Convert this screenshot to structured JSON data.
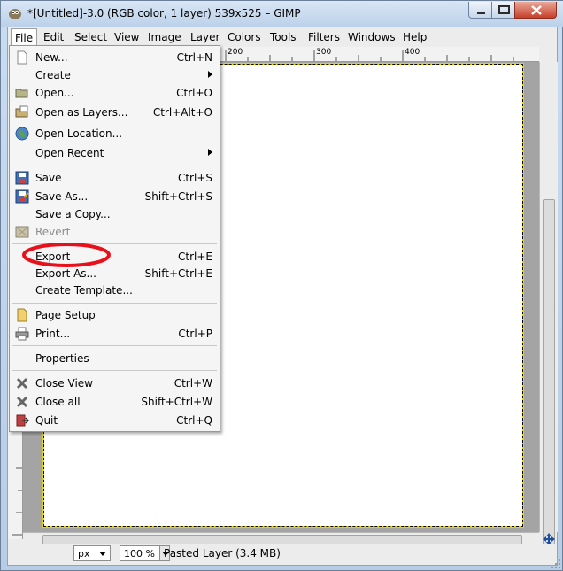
{
  "window": {
    "title": "*[Untitled]-3.0 (RGB color, 1 layer) 539x525 – GIMP",
    "icons": {
      "app": "gimp-icon",
      "minimize": "minimize-icon",
      "maximize": "maximize-icon",
      "close": "close-icon"
    }
  },
  "menubar": {
    "file": "File",
    "edit": "Edit",
    "select": "Select",
    "view": "View",
    "image": "Image",
    "layer": "Layer",
    "colors": "Colors",
    "tools": "Tools",
    "filters": "Filters",
    "windows": "Windows",
    "help": "Help"
  },
  "ruler": {
    "t200": "200",
    "t300": "300",
    "t400": "400"
  },
  "file_menu": {
    "new": {
      "label": "New...",
      "shortcut": "Ctrl+N"
    },
    "create": {
      "label": "Create"
    },
    "open": {
      "label": "Open...",
      "shortcut": "Ctrl+O"
    },
    "open_layers": {
      "label": "Open as Layers...",
      "shortcut": "Ctrl+Alt+O"
    },
    "open_location": {
      "label": "Open Location..."
    },
    "open_recent": {
      "label": "Open Recent"
    },
    "save": {
      "label": "Save",
      "shortcut": "Ctrl+S"
    },
    "save_as": {
      "label": "Save As...",
      "shortcut": "Shift+Ctrl+S"
    },
    "save_copy": {
      "label": "Save a Copy..."
    },
    "revert": {
      "label": "Revert"
    },
    "export": {
      "label": "Export",
      "shortcut": "Ctrl+E"
    },
    "export_as": {
      "label": "Export As...",
      "shortcut": "Shift+Ctrl+E"
    },
    "create_template": {
      "label": "Create Template..."
    },
    "page_setup": {
      "label": "Page Setup"
    },
    "print": {
      "label": "Print...",
      "shortcut": "Ctrl+P"
    },
    "properties": {
      "label": "Properties"
    },
    "close_view": {
      "label": "Close View",
      "shortcut": "Ctrl+W"
    },
    "close_all": {
      "label": "Close all",
      "shortcut": "Shift+Ctrl+W"
    },
    "quit": {
      "label": "Quit",
      "shortcut": "Ctrl+Q"
    }
  },
  "statusbar": {
    "unit": "px",
    "zoom": "100 %",
    "message": "Pasted Layer (3.4 MB)"
  },
  "colors": {
    "annotation_circle": "#e8101a",
    "selection_marching": "#e8d300"
  }
}
